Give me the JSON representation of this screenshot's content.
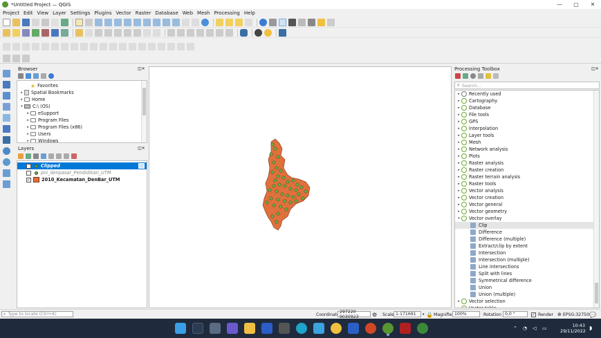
{
  "window": {
    "title": "*Untitled Project — QGIS"
  },
  "menu": [
    "Project",
    "Edit",
    "View",
    "Layer",
    "Settings",
    "Plugins",
    "Vector",
    "Raster",
    "Database",
    "Web",
    "Mesh",
    "Processing",
    "Help"
  ],
  "browser": {
    "title": "Browser",
    "items": [
      {
        "label": "Favorites",
        "icon": "star-icon",
        "indent": 1,
        "arrow": ""
      },
      {
        "label": "Spatial Bookmarks",
        "icon": "bookmark-icon",
        "indent": 0,
        "arrow": "▸"
      },
      {
        "label": "Home",
        "icon": "folder-icon",
        "indent": 0,
        "arrow": "▸"
      },
      {
        "label": "C:\\ (OS)",
        "icon": "drive-icon",
        "indent": 0,
        "arrow": "▾"
      },
      {
        "label": "eSupport",
        "icon": "folder-icon",
        "indent": 1,
        "arrow": "▸"
      },
      {
        "label": "Program Files",
        "icon": "folder-icon",
        "indent": 1,
        "arrow": "▸"
      },
      {
        "label": "Program Files (x86)",
        "icon": "folder-icon",
        "indent": 1,
        "arrow": "▸"
      },
      {
        "label": "Users",
        "icon": "folder-icon",
        "indent": 1,
        "arrow": "▸"
      },
      {
        "label": "Windows",
        "icon": "folder-icon",
        "indent": 1,
        "arrow": "▸"
      }
    ]
  },
  "layers": {
    "title": "Layers",
    "items": [
      {
        "label": "Clipped",
        "checked": true,
        "selected": true,
        "symbol": "#6ab04c",
        "style": "bold-italic"
      },
      {
        "label": "poi_denpasar_Pendidikan_UTM",
        "checked": false,
        "selected": false,
        "symbol": "#6ab04c",
        "style": "italic-gray"
      },
      {
        "label": "2010_Kecamatan_DenBar_UTM",
        "checked": true,
        "selected": false,
        "symbol": "#e0703c",
        "style": "bold"
      }
    ]
  },
  "toolbox": {
    "title": "Processing Toolbox",
    "search_placeholder": "Search...",
    "groups": [
      "Recently used",
      "Cartography",
      "Database",
      "File tools",
      "GPS",
      "Interpolation",
      "Layer tools",
      "Mesh",
      "Network analysis",
      "Plots",
      "Raster analysis",
      "Raster creation",
      "Raster terrain analysis",
      "Raster tools",
      "Vector analysis",
      "Vector creation",
      "Vector general",
      "Vector geometry",
      "Vector overlay"
    ],
    "overlay_children": [
      "Clip",
      "Difference",
      "Difference (multiple)",
      "Extract/clip by extent",
      "Intersection",
      "Intersection (multiple)",
      "Line intersections",
      "Split with lines",
      "Symmetrical difference",
      "Union",
      "Union (multiple)"
    ],
    "after_groups": [
      "Vector selection",
      "Vector table"
    ]
  },
  "status": {
    "locate_placeholder": "Type to locate (Ctrl+K)",
    "coordinate_label": "Coordinate",
    "coordinate": "297220 9030923",
    "scale_label": "Scale",
    "scale": "1:171691",
    "magnifier_label": "Magnifier",
    "magnifier": "100%",
    "rotation_label": "Rotation",
    "rotation": "0,0 °",
    "render_label": "Render",
    "crs": "EPSG:32750"
  },
  "clock": {
    "time": "10:43",
    "date": "29/11/2022"
  },
  "colors": {
    "polygon": "#e0703c",
    "points": "#6ab04c",
    "accent": "#0078d7"
  }
}
